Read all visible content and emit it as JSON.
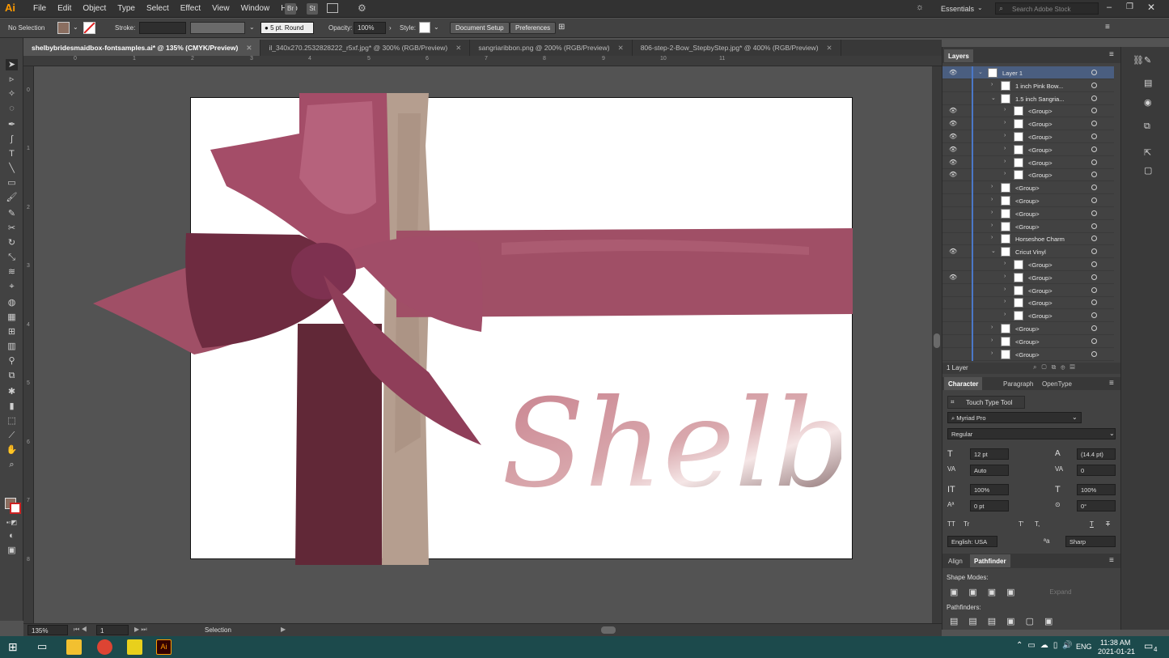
{
  "app": {
    "logo": "Ai"
  },
  "menu": [
    "File",
    "Edit",
    "Object",
    "Type",
    "Select",
    "Effect",
    "View",
    "Window",
    "Help"
  ],
  "menubar_buttons": {
    "bridge": "Br",
    "stock": "St"
  },
  "workspace": {
    "name": "Essentials",
    "search_placeholder": "Search Adobe Stock"
  },
  "control": {
    "selection": "No Selection",
    "stroke_label": "Stroke:",
    "brush": "5 pt. Round",
    "opacity_label": "Opacity:",
    "opacity_value": "100%",
    "style_label": "Style:",
    "document_setup": "Document Setup",
    "preferences": "Preferences"
  },
  "doc_tabs": [
    {
      "label": "shelbybridesmaidbox-fontsamples.ai* @ 135% (CMYK/Preview)",
      "active": true
    },
    {
      "label": "il_340x270.2532828222_r5xf.jpg* @ 300% (RGB/Preview)",
      "active": false
    },
    {
      "label": "sangriaribbon.png @ 200% (RGB/Preview)",
      "active": false
    },
    {
      "label": "806-step-2-Bow_StepbyStep.jpg* @ 400% (RGB/Preview)",
      "active": false
    }
  ],
  "ruler_top": [
    "0",
    "1",
    "2",
    "3",
    "4",
    "5",
    "6",
    "7",
    "8",
    "9",
    "10",
    "11"
  ],
  "ruler_left": [
    "0",
    "1",
    "2",
    "3",
    "4",
    "5",
    "6",
    "7",
    "8"
  ],
  "artboard": {
    "script_text": "Shelby"
  },
  "status": {
    "zoom": "135%",
    "artboard_num": "1",
    "tool": "Selection"
  },
  "layers_panel": {
    "title": "Layers",
    "footer": "1 Layer",
    "rows": [
      {
        "name": "Layer 1",
        "visible": true,
        "indent": 0,
        "expanded": true
      },
      {
        "name": "1 inch Pink Bow...",
        "visible": false,
        "indent": 1,
        "expanded": false
      },
      {
        "name": "1.5 inch Sangria...",
        "visible": false,
        "indent": 1,
        "expanded": true
      },
      {
        "name": "<Group>",
        "visible": true,
        "indent": 2,
        "expanded": false
      },
      {
        "name": "<Group>",
        "visible": true,
        "indent": 2,
        "expanded": false
      },
      {
        "name": "<Group>",
        "visible": true,
        "indent": 2,
        "expanded": false
      },
      {
        "name": "<Group>",
        "visible": true,
        "indent": 2,
        "expanded": false
      },
      {
        "name": "<Group>",
        "visible": true,
        "indent": 2,
        "expanded": false
      },
      {
        "name": "<Group>",
        "visible": true,
        "indent": 2,
        "expanded": false
      },
      {
        "name": "<Group>",
        "visible": false,
        "indent": 1,
        "expanded": false
      },
      {
        "name": "<Group>",
        "visible": false,
        "indent": 1,
        "expanded": false
      },
      {
        "name": "<Group>",
        "visible": false,
        "indent": 1,
        "expanded": false
      },
      {
        "name": "<Group>",
        "visible": false,
        "indent": 1,
        "expanded": false
      },
      {
        "name": "Horseshoe Charm",
        "visible": false,
        "indent": 1,
        "expanded": false
      },
      {
        "name": "Cricut Vinyl",
        "visible": true,
        "indent": 1,
        "expanded": true
      },
      {
        "name": "<Group>",
        "visible": false,
        "indent": 2,
        "expanded": false
      },
      {
        "name": "<Group>",
        "visible": true,
        "indent": 2,
        "expanded": false
      },
      {
        "name": "<Group>",
        "visible": false,
        "indent": 2,
        "expanded": false
      },
      {
        "name": "<Group>",
        "visible": false,
        "indent": 2,
        "expanded": false
      },
      {
        "name": "<Group>",
        "visible": false,
        "indent": 2,
        "expanded": false
      },
      {
        "name": "<Group>",
        "visible": false,
        "indent": 1,
        "expanded": false
      },
      {
        "name": "<Group>",
        "visible": false,
        "indent": 1,
        "expanded": false
      },
      {
        "name": "<Group>",
        "visible": false,
        "indent": 1,
        "expanded": false
      }
    ]
  },
  "character_panel": {
    "tabs": [
      "Character",
      "Paragraph",
      "OpenType"
    ],
    "touch_type": "Touch Type Tool",
    "font_family": "Myriad Pro",
    "font_style": "Regular",
    "font_size": "12 pt",
    "leading": "(14.4 pt)",
    "kerning": "Auto",
    "tracking": "0",
    "vscale": "100%",
    "hscale": "100%",
    "baseline": "0 pt",
    "rotation": "0°",
    "tt_buttons": [
      "TT",
      "Tr",
      "T'",
      "T,",
      "T",
      "T"
    ],
    "language": "English: USA",
    "aa_label": "ªa",
    "antialias": "Sharp"
  },
  "pathfinder_panel": {
    "tabs": [
      "Align",
      "Pathfinder"
    ],
    "shape_modes": "Shape Modes:",
    "expand": "Expand",
    "pathfinders": "Pathfinders:"
  },
  "taskbar": {
    "time": "11:38 AM",
    "date": "2021-01-21",
    "lang": "ENG",
    "notif": "4"
  }
}
